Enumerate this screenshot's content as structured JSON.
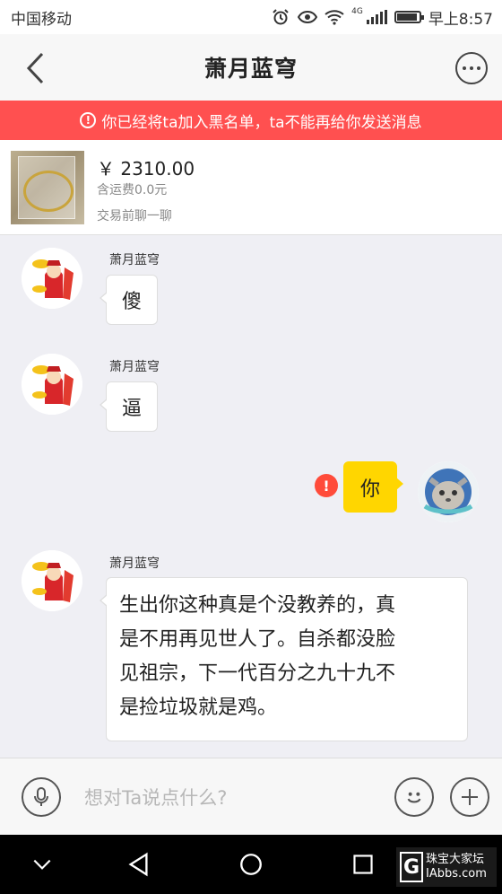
{
  "status_bar": {
    "carrier": "中国移动",
    "network": "4G",
    "time": "早上8:57",
    "icons": [
      "alarm-icon",
      "eye-icon",
      "wifi-icon",
      "signal-icon",
      "battery-icon"
    ]
  },
  "header": {
    "title": "萧月蓝穹",
    "back_icon": "chevron-left-icon",
    "more_icon": "more-icon"
  },
  "banner": {
    "text": "你已经将ta加入黑名单，ta不能再给你发送消息",
    "icon": "alert-icon",
    "color": "#ff5050"
  },
  "product": {
    "price": "￥ 2310.00",
    "shipping": "含运费0.0元",
    "note": "交易前聊一聊"
  },
  "messages": [
    {
      "direction": "in",
      "sender": "萧月蓝穹",
      "lines": [
        "傻"
      ]
    },
    {
      "direction": "in",
      "sender": "萧月蓝穹",
      "lines": [
        "逼"
      ]
    },
    {
      "direction": "out",
      "lines": [
        "你"
      ],
      "status": "failed"
    },
    {
      "direction": "in",
      "sender": "萧月蓝穹",
      "lines": [
        "生出你这种真是个没教养的，真",
        "是不用再见世人了。自杀都没脸",
        "见祖宗，下一代百分之九十九不",
        "是捡垃圾就是鸡。"
      ]
    }
  ],
  "input_bar": {
    "placeholder": "想对Ta说点什么?",
    "voice_icon": "microphone-icon",
    "emoji_icon": "smiley-icon",
    "add_icon": "plus-icon"
  },
  "nav_bar": {
    "icons": [
      "chevron-down-icon",
      "back-triangle-icon",
      "home-circle-icon",
      "recents-square-icon"
    ]
  },
  "watermark": {
    "logo_letter": "G",
    "line1": "珠宝大家坛",
    "line2": "IAbbs.com"
  },
  "colors": {
    "outgoing_bubble": "#ffd600",
    "alert_red": "#ff4b3a",
    "background": "#efeff4"
  }
}
